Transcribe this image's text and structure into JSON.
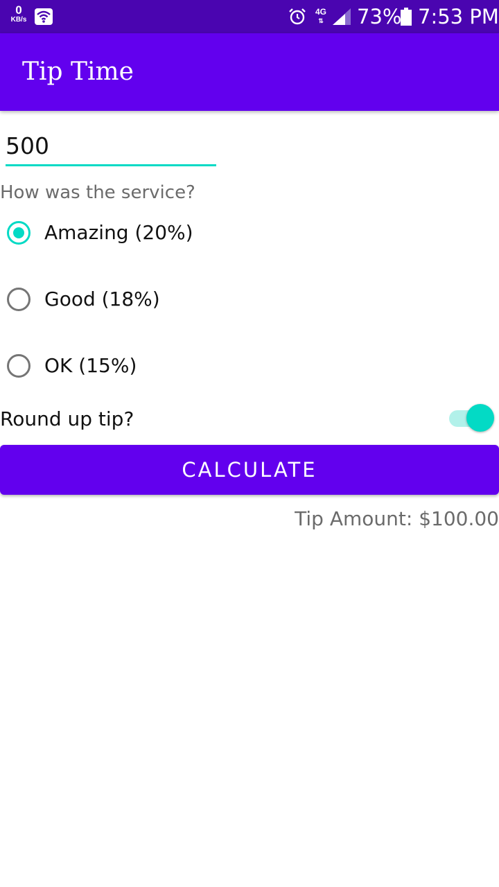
{
  "status_bar": {
    "data_speed": "0",
    "data_speed_unit": "KB/s",
    "network": "4G",
    "battery_percent": "73%",
    "time": "7:53 PM",
    "icons": [
      "wifi-icon",
      "alarm-icon",
      "signal-icon",
      "battery-icon"
    ]
  },
  "app_bar": {
    "title": "Tip Time"
  },
  "form": {
    "cost_value": "500",
    "service_question": "How was the service?",
    "options": [
      {
        "label": "Amazing (20%)",
        "selected": true
      },
      {
        "label": "Good (18%)",
        "selected": false
      },
      {
        "label": "OK (15%)",
        "selected": false
      }
    ],
    "round_up_label": "Round up tip?",
    "round_up_enabled": true,
    "calculate_label": "Calculate",
    "tip_result": "Tip Amount: $100.00"
  },
  "colors": {
    "status_bar": "#4a05b0",
    "primary": "#6200ee",
    "accent": "#03dac5",
    "secondary_text": "#6b6b6b"
  }
}
